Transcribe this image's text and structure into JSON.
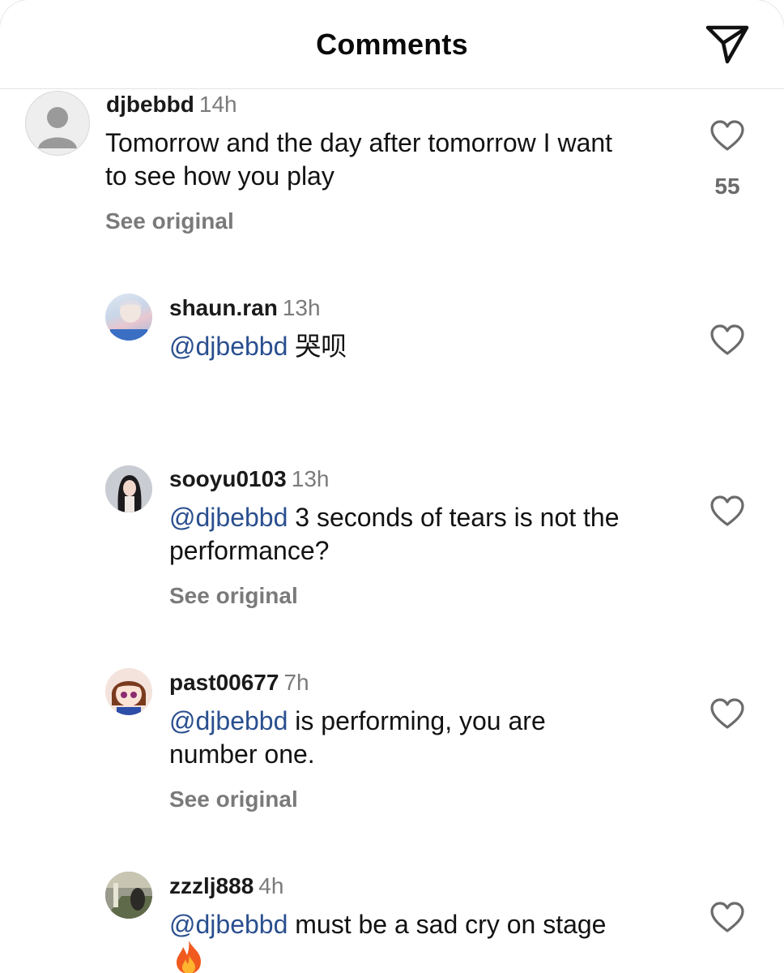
{
  "header": {
    "title": "Comments",
    "send_icon": "send-paper-plane-icon"
  },
  "comments": [
    {
      "username": "djbebbd",
      "time": "14h",
      "text": "Tomorrow and the day after tomorrow I want to see how you play",
      "see_original": "See original",
      "likes": "55",
      "avatar": "default-avatar-icon"
    },
    {
      "username": "shaun.ran",
      "time": "13h",
      "mention": "@djbebbd",
      "text": " 哭呗",
      "avatar": "profile-photo"
    },
    {
      "username": "sooyu0103",
      "time": "13h",
      "mention": "@djbebbd",
      "text": " 3 seconds of tears is not the performance?",
      "see_original": "See original",
      "avatar": "profile-photo"
    },
    {
      "username": "past00677",
      "time": "7h",
      "mention": "@djbebbd",
      "text": " is performing, you are number one.",
      "see_original": "See original",
      "avatar": "cartoon-avatar"
    },
    {
      "username": "zzzlj888",
      "time": "4h",
      "mention": "@djbebbd",
      "text": " must be a sad cry on stage",
      "emoji": "fire-emoji-icon",
      "avatar": "profile-photo"
    }
  ],
  "colors": {
    "mention": "#2a4f8f",
    "muted": "#7a7a7a",
    "divider": "#e2e2e2"
  }
}
